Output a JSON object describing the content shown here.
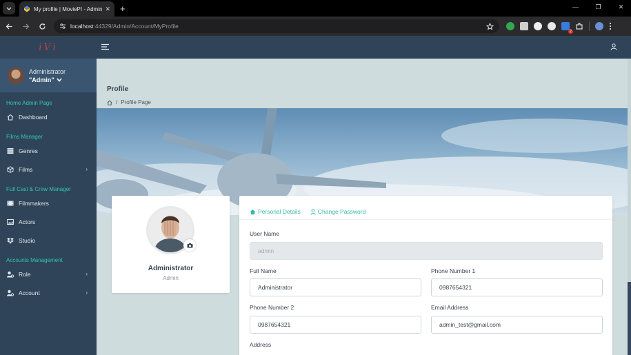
{
  "browser": {
    "tab_title": "My profile | MoviePI - Admin",
    "tab_close": "✕",
    "new_tab": "+",
    "url_host": "localhost",
    "url_path": ":44329/Admin/Account/MyProfile",
    "extension_badge": "2",
    "window_controls": [
      "—",
      "❐",
      "✕"
    ]
  },
  "app": {
    "logo": "iVi",
    "user": {
      "name": "Administrator",
      "role": "\"Admin\""
    }
  },
  "sidebar": {
    "sections": [
      {
        "title": "Home Admin Page",
        "items": [
          {
            "label": "Dashboard",
            "icon": "home-icon",
            "chevron": false
          }
        ]
      },
      {
        "title": "Films Manager",
        "items": [
          {
            "label": "Genres",
            "icon": "list-icon",
            "chevron": false
          },
          {
            "label": "Films",
            "icon": "cube-icon",
            "chevron": true
          }
        ]
      },
      {
        "title": "Full Cast & Crew Manager",
        "items": [
          {
            "label": "Filmmakers",
            "icon": "film-icon",
            "chevron": false
          },
          {
            "label": "Actors",
            "icon": "image-icon",
            "chevron": false
          },
          {
            "label": "Studio",
            "icon": "dropbox-icon",
            "chevron": false
          }
        ]
      },
      {
        "title": "Accounts Management",
        "items": [
          {
            "label": "Role",
            "icon": "user-cog-icon",
            "chevron": true
          },
          {
            "label": "Account",
            "icon": "user-cog-icon",
            "chevron": true
          }
        ]
      }
    ],
    "chevron_glyph": "›"
  },
  "page": {
    "title": "Profile",
    "breadcrumb_sep": "/",
    "breadcrumb_current": "Profile Page"
  },
  "profile_card": {
    "name": "Administrator",
    "role": "Admin"
  },
  "form": {
    "tabs": [
      {
        "label": "Personal Details",
        "icon": "home-icon"
      },
      {
        "label": "Change Password",
        "icon": "user-icon"
      }
    ],
    "fields": {
      "username": {
        "label": "User Name",
        "value": "admin"
      },
      "fullname": {
        "label": "Full Name",
        "value": "Administrator"
      },
      "phone1": {
        "label": "Phone Number 1",
        "value": "0987654321"
      },
      "phone2": {
        "label": "Phone Number 2",
        "value": "0987654321"
      },
      "email": {
        "label": "Email Address",
        "value": "admin_test@gmail.com"
      },
      "address": {
        "label": "Address"
      }
    }
  },
  "colors": {
    "accent": "#35c4b5",
    "sidebar": "#2f4458",
    "brand": "#c23a4b"
  }
}
